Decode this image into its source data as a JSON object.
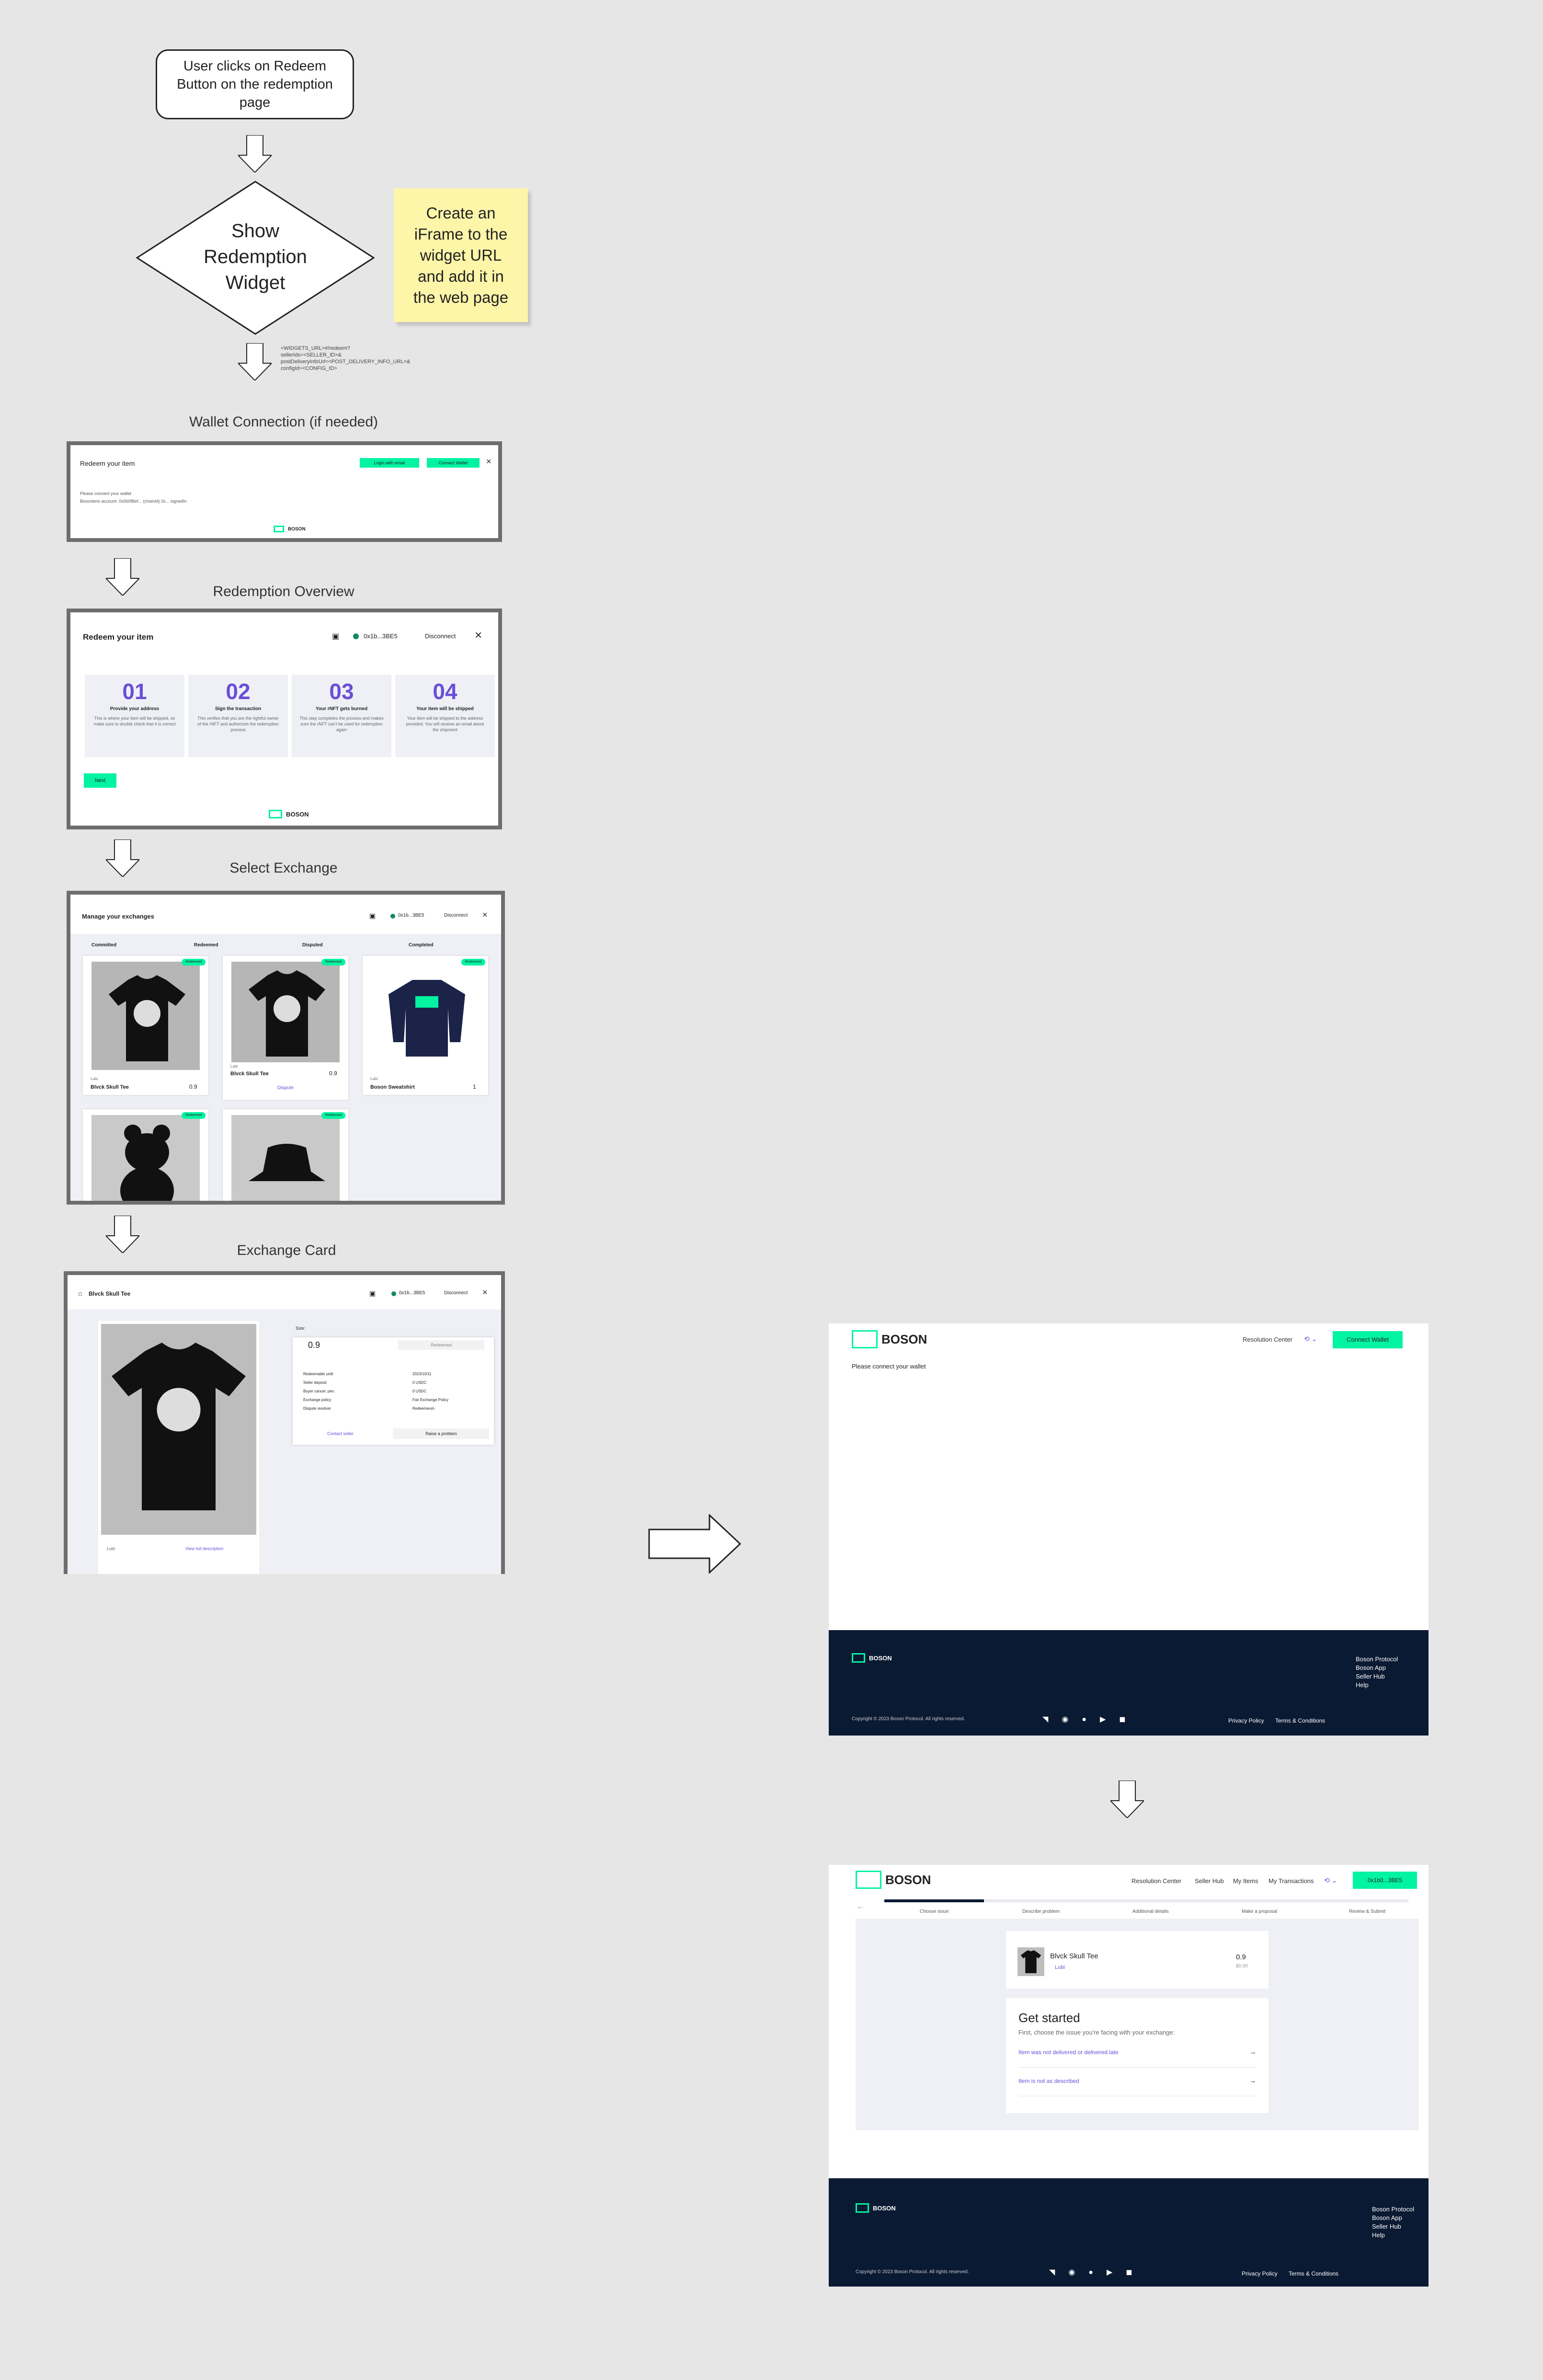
{
  "flow": {
    "start_node": "User clicks on Redeem Button on the redemption page",
    "decision_node": "Show Redemption Widget",
    "sticky_note": "Create an iFrame to the widget URL and add it in the web page",
    "url_note_lines": [
      "<WIDGETS_URL>#/redeem?",
      "sellerIds=<SELLER_ID>&",
      "postDeliveryInfoUrl=<POST_DELIVERY_INFO_URL>&",
      "configId=<CONFIG_ID>"
    ],
    "step_wallet": "Wallet Connection (if needed)",
    "step_overview": "Redemption Overview",
    "step_select": "Select Exchange",
    "step_card": "Exchange Card"
  },
  "wallet_screen": {
    "title": "Redeem your item",
    "btn_a": "Login with email",
    "btn_b": "Connect Wallet",
    "msg_1": "Please connect your wallet",
    "msg_2": "Bosonlens account: 0x0b0fBef... (chainId) 0x... signedIn",
    "brand": "BOSON"
  },
  "overview_screen": {
    "title": "Redeem your item",
    "address": "0x1b...3BE5",
    "disconnect": "Disconnect",
    "next": "Next",
    "brand": "BOSON",
    "steps": [
      {
        "num": "01",
        "title": "Provide your address",
        "desc": "This is where your item will be shipped, so make sure to double check that it is correct"
      },
      {
        "num": "02",
        "title": "Sign the transaction",
        "desc": "This verifies that you are the rightful owner of the rNFT and authorizes the redemption process"
      },
      {
        "num": "03",
        "title": "Your rNFT gets burned",
        "desc": "This step completes the process and makes sure the rNFT can't be used for redemption again"
      },
      {
        "num": "04",
        "title": "Your item will be shipped",
        "desc": "Your item will be shipped to the address provided. You will receive an email about the shipment"
      }
    ]
  },
  "select_screen": {
    "title": "Manage your exchanges",
    "address": "0x1b...3BE5",
    "disconnect": "Disconnect",
    "tabs": [
      "Committed",
      "Redeemed",
      "Disputed",
      "Completed"
    ],
    "badge": "Redeemed",
    "seller": "Lubi",
    "dispute_label": "Dispute",
    "items": [
      {
        "name": "Blvck Skull Tee",
        "price": "0.9"
      },
      {
        "name": "Blvck Skull Tee",
        "price": "0.9"
      },
      {
        "name": "Boson Sweatshirt",
        "price": "1"
      }
    ]
  },
  "card_screen": {
    "title": "Blvck Skull Tee",
    "address": "0x1b...3BE5",
    "disconnect": "Disconnect",
    "price": "0.9",
    "redeemed": "Redeemed",
    "size_label": "Size:",
    "rows": [
      {
        "k": "Redeemable until",
        "v": "2023/10/11"
      },
      {
        "k": "Seller deposit",
        "v": "0 USDC"
      },
      {
        "k": "Buyer cancel. pen.",
        "v": "0 USDC"
      },
      {
        "k": "Exchange policy",
        "v": "Fair Exchange Policy"
      },
      {
        "k": "Dispute resolver",
        "v": "Redeemeum"
      }
    ],
    "contact": "Contact seller",
    "raise": "Raise a problem",
    "seller": "Lubi",
    "view_full": "View full description"
  },
  "dapp_connect": {
    "brand": "BOSON",
    "nav": [
      "Resolution Center"
    ],
    "connect": "Connect Wallet",
    "message": "Please connect your wallet",
    "footer_links": [
      "Boson Protocol",
      "Boson App",
      "Seller Hub",
      "Help"
    ],
    "copyright": "Copyright © 2023 Boson Protocol. All rights reserved.",
    "privacy": "Privacy Policy",
    "terms": "Terms & Conditions"
  },
  "dapp_dispute": {
    "brand": "BOSON",
    "nav": [
      "Resolution Center",
      "Seller Hub",
      "My Items",
      "My Transactions"
    ],
    "address": "0x1b0...3BE5",
    "progress": [
      "Choose issue",
      "Describe problem",
      "Additional details",
      "Make a proposal",
      "Review & Submit"
    ],
    "item_name": "Blvck Skull Tee",
    "seller": "Lubi",
    "price": "0.9",
    "price_usd": "$0.90",
    "heading": "Get started",
    "subheading": "First, choose the issue you're facing with your exchange:",
    "options": [
      "Item was not delivered or delivered late",
      "Item is not as described"
    ],
    "footer_links": [
      "Boson Protocol",
      "Boson App",
      "Seller Hub",
      "Help"
    ],
    "copyright": "Copyright © 2023 Boson Protocol. All rights reserved.",
    "privacy": "Privacy Policy",
    "terms": "Terms & Conditions"
  },
  "colors": {
    "accent": "#02f3a2",
    "navy": "#0b1a33",
    "purple": "#6b4ed8",
    "sticky": "#fdf5a8"
  }
}
